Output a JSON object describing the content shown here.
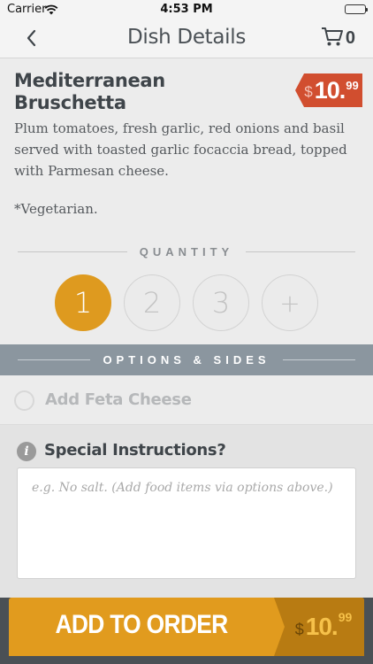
{
  "status_bar": {
    "carrier": "Carrier",
    "time": "4:53 PM"
  },
  "nav": {
    "title": "Dish Details",
    "cart_count": "0",
    "back_icon": "chevron-left-icon",
    "cart_icon": "cart-icon"
  },
  "dish": {
    "name_line1": "Mediterranean",
    "name_line2": "Bruschetta",
    "price_symbol": "$",
    "price_main": "10.",
    "price_cents": "99",
    "description": "Plum tomatoes, fresh garlic, red onions and basil served with toasted garlic focaccia bread, topped with Parmesan cheese.",
    "note": "*Vegetarian."
  },
  "quantity": {
    "heading": "QUANTITY",
    "options": [
      "1",
      "2",
      "3",
      "+"
    ],
    "selected": "1"
  },
  "options": {
    "heading": "OPTIONS & SIDES",
    "items": [
      {
        "label": "Add Feta Cheese",
        "checked": false
      }
    ]
  },
  "special_instructions": {
    "heading": "Special Instructions?",
    "placeholder": "e.g. No salt. (Add food items via options above.)",
    "value": ""
  },
  "add_to_order": {
    "label": "ADD TO ORDER",
    "price_symbol": "$",
    "price_main": "10.",
    "price_cents": "99"
  },
  "colors": {
    "accent_orange": "#de9a1f",
    "price_red": "#d14e2f",
    "options_bar": "#8b969f"
  }
}
